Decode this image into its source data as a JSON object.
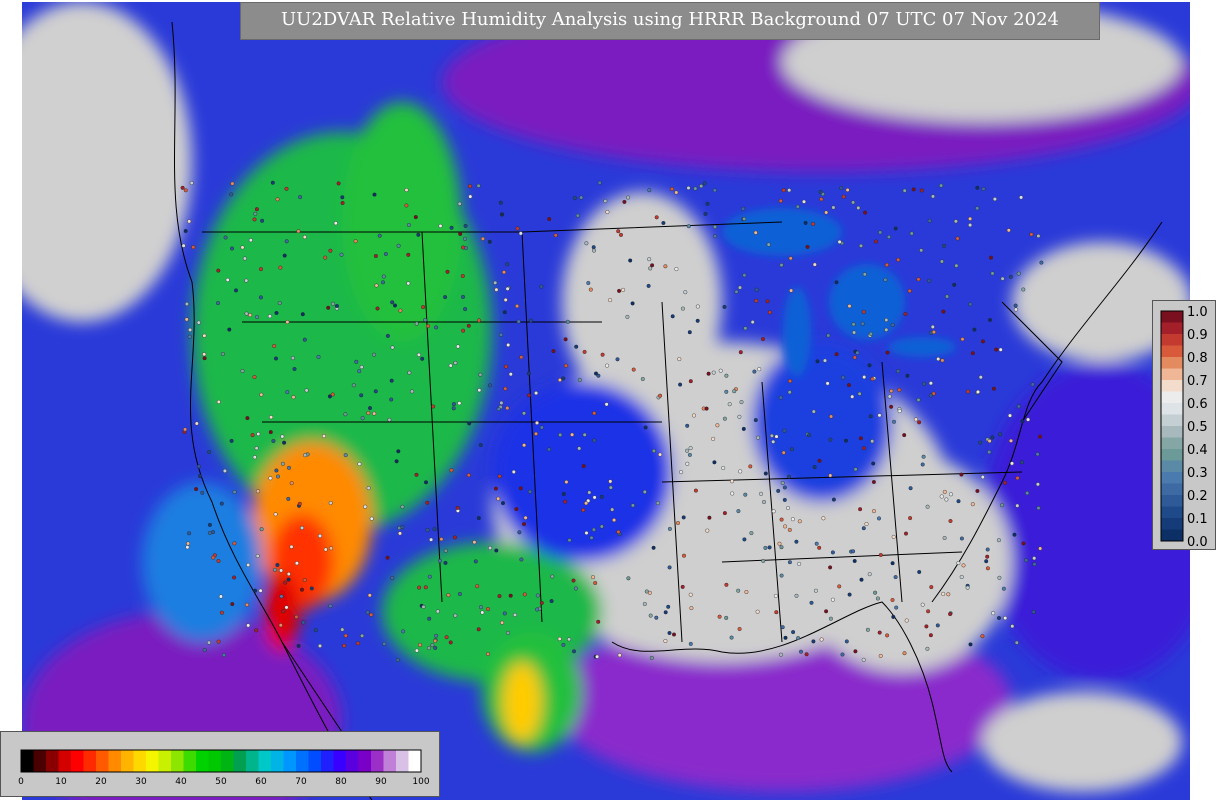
{
  "title": "UU2DVAR Relative Humidity Analysis using HRRR Background 07 UTC 07 Nov 2024",
  "observation_legend": {
    "labels": [
      "1.0",
      "0.9",
      "0.8",
      "0.7",
      "0.6",
      "0.5",
      "0.4",
      "0.3",
      "0.2",
      "0.1",
      "0.0"
    ],
    "colors": [
      "#7a0f1f",
      "#a3202b",
      "#c23a30",
      "#d85a3a",
      "#e38a5e",
      "#efb796",
      "#f4dccc",
      "#ececec",
      "#dde3e6",
      "#c4cfd4",
      "#a7b9bd",
      "#84a6a5",
      "#6b9a98",
      "#5a8aa6",
      "#4a7aae",
      "#3e6aa3",
      "#2f5a98",
      "#1f4a8a",
      "#153c78",
      "#0c2f66"
    ]
  },
  "rh_colorbar": {
    "labels": [
      "0",
      "10",
      "20",
      "30",
      "40",
      "50",
      "60",
      "70",
      "80",
      "90",
      "100"
    ],
    "colors": [
      "#000000",
      "#4a0000",
      "#8a0000",
      "#d40000",
      "#ff0000",
      "#ff2a00",
      "#ff5a00",
      "#ff8a00",
      "#ffb400",
      "#ffd800",
      "#f5f500",
      "#c8f000",
      "#8ce600",
      "#3cdc00",
      "#00d200",
      "#00c800",
      "#00b414",
      "#00a050",
      "#00b48c",
      "#00c8c8",
      "#00b4e6",
      "#0096ff",
      "#0070ff",
      "#004cff",
      "#2020ff",
      "#3a00ff",
      "#5a00e0",
      "#7a00c8",
      "#9a30c8",
      "#c080d8",
      "#d8c0e6",
      "#ffffff"
    ]
  }
}
